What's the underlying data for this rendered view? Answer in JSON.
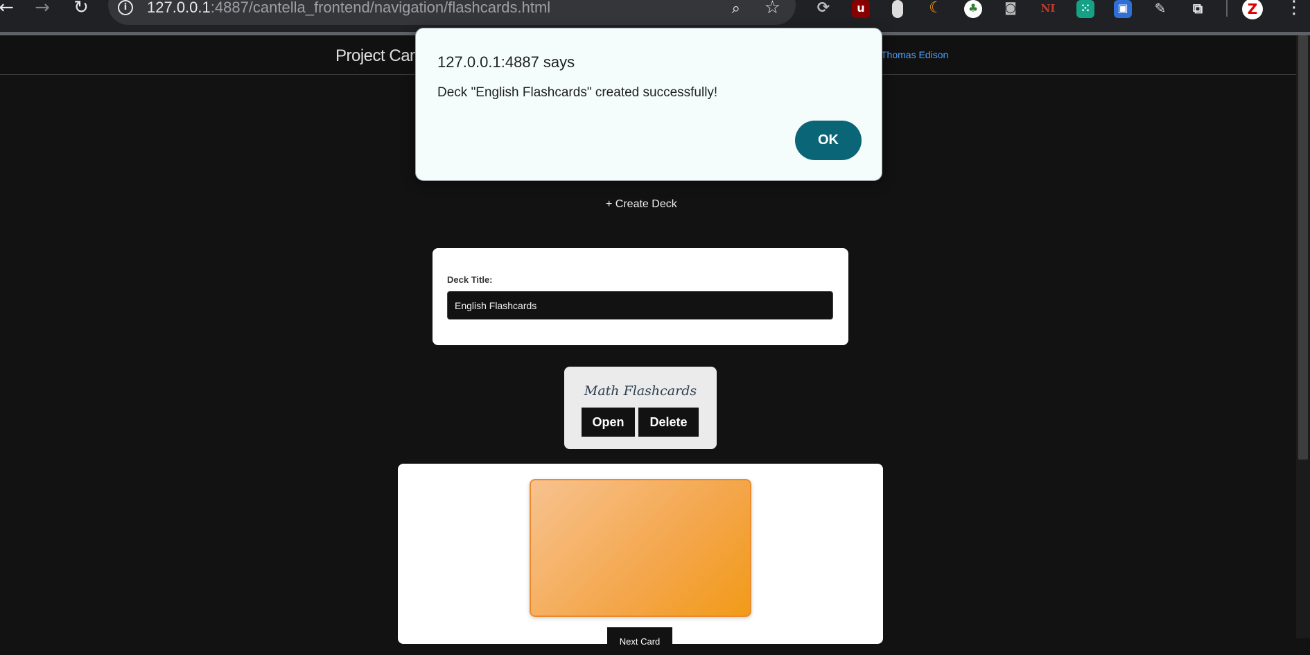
{
  "browser": {
    "url_host": "127.0.0.1",
    "url_rest": ":4887/cantella_frontend/navigation/flashcards.html",
    "extensions": [
      "refresh-ext",
      "ublock",
      "ext-orange",
      "ext-moon",
      "ext-tree",
      "camera-ext",
      "ni-ext",
      "ext-green",
      "ext-blue",
      "pen-ext",
      "puzzle-ext"
    ],
    "profile_letter": "Z"
  },
  "header": {
    "site_title": "Project Cant",
    "user_name": "Thomas Edison"
  },
  "main": {
    "create_deck_label": "+ Create Deck",
    "deck_form": {
      "label": "Deck Title:",
      "value": "English Flashcards"
    },
    "decks": [
      {
        "name": "Math Flashcards",
        "open_label": "Open",
        "delete_label": "Delete"
      }
    ],
    "next_card_label": "Next Card"
  },
  "dialog": {
    "title": "127.0.0.1:4887 says",
    "message": "Deck \"English Flashcards\" created successfully!",
    "ok_label": "OK"
  },
  "colors": {
    "accent_button": "#0a6577",
    "user_link": "#4da3ff",
    "flashcard": "#f4a64a"
  }
}
